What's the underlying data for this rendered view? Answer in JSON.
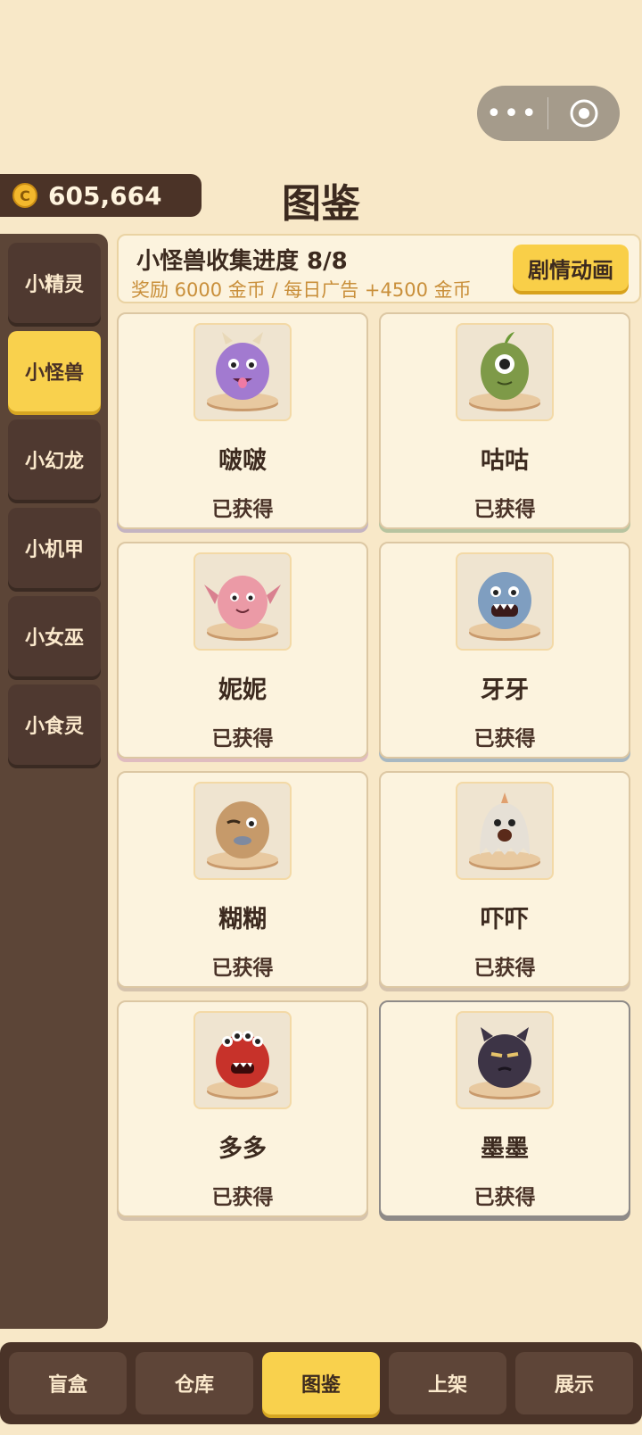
{
  "capsule": {
    "more_icon": "more-dots-icon",
    "close_icon": "target-circle-icon"
  },
  "coins": {
    "icon": "coin-icon",
    "symbol": "C",
    "amount": "605,664"
  },
  "page_title": "图鉴",
  "sidebar": {
    "items": [
      {
        "label": "小精灵",
        "active": false
      },
      {
        "label": "小怪兽",
        "active": true
      },
      {
        "label": "小幻龙",
        "active": false
      },
      {
        "label": "小机甲",
        "active": false
      },
      {
        "label": "小女巫",
        "active": false
      },
      {
        "label": "小食灵",
        "active": false
      }
    ]
  },
  "banner": {
    "progress": "小怪兽收集进度 8/8",
    "reward": "奖励 6000 金币 / 每日广告 +4500 金币",
    "story_button": "剧情动画"
  },
  "cards": [
    {
      "name": "啵啵",
      "status": "已获得",
      "color": "#a27ad0"
    },
    {
      "name": "咕咕",
      "status": "已获得",
      "color": "#7e9a48"
    },
    {
      "name": "妮妮",
      "status": "已获得",
      "color": "#eb9aa6"
    },
    {
      "name": "牙牙",
      "status": "已获得",
      "color": "#7f9ec0"
    },
    {
      "name": "糊糊",
      "status": "已获得",
      "color": "#c69a6a"
    },
    {
      "name": "吓吓",
      "status": "已获得",
      "color": "#e6e0d6"
    },
    {
      "name": "多多",
      "status": "已获得",
      "color": "#c7322a"
    },
    {
      "name": "墨墨",
      "status": "已获得",
      "color": "#3d3446"
    }
  ],
  "bottom_nav": {
    "items": [
      {
        "label": "盲盒",
        "active": false
      },
      {
        "label": "仓库",
        "active": false
      },
      {
        "label": "图鉴",
        "active": true
      },
      {
        "label": "上架",
        "active": false
      },
      {
        "label": "展示",
        "active": false
      }
    ]
  }
}
